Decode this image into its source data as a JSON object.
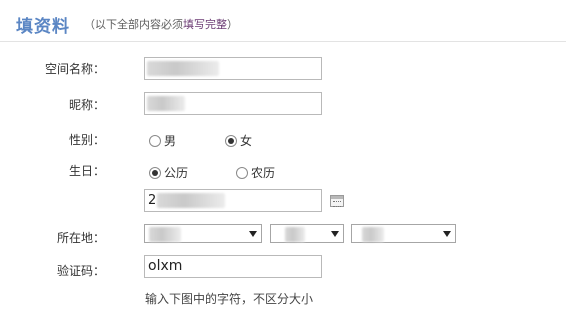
{
  "header": {
    "title": "填资料",
    "note_prefix": "（以下全部内容必须",
    "note_highlight": "填写完整",
    "note_suffix": "）"
  },
  "form": {
    "space_name": {
      "label": "空间名称：",
      "value": ""
    },
    "nickname": {
      "label": "昵称：",
      "value": ""
    },
    "gender": {
      "label": "性别：",
      "options": [
        {
          "label": "男",
          "checked": false
        },
        {
          "label": "女",
          "checked": true
        }
      ]
    },
    "birthday": {
      "label": "生日：",
      "calendar_options": [
        {
          "label": "公历",
          "checked": true
        },
        {
          "label": "农历",
          "checked": false
        }
      ],
      "date_value": "2"
    },
    "location": {
      "label": "所在地：",
      "country": "",
      "province": "",
      "city": ""
    },
    "captcha": {
      "label": "验证码：",
      "value": "olxm",
      "hint": "输入下图中的字符，不区分大小"
    }
  }
}
